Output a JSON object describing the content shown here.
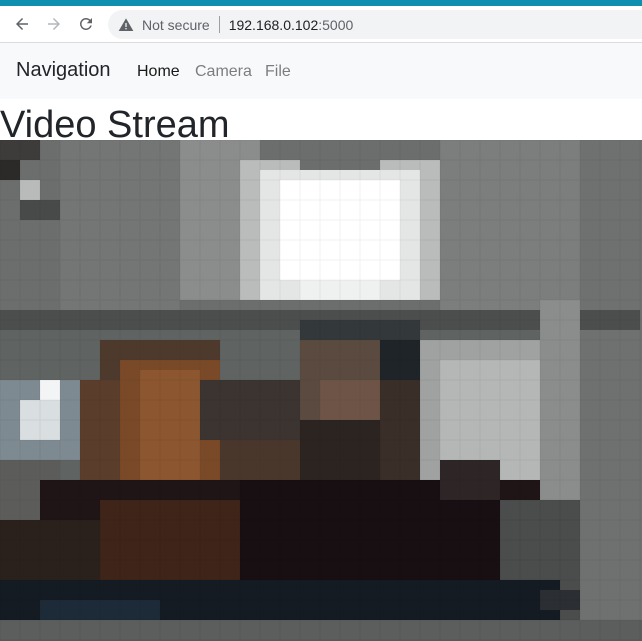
{
  "browser": {
    "security_text": "Not secure",
    "url_host": "192.168.0.102",
    "url_port": ":5000",
    "icons": [
      "back-arrow-icon",
      "forward-arrow-icon",
      "reload-icon",
      "warning-icon"
    ]
  },
  "navbar": {
    "brand": "Navigation",
    "links": [
      {
        "label": "Home",
        "active": true
      },
      {
        "label": "Camera",
        "active": false
      },
      {
        "label": "File",
        "active": false
      }
    ]
  },
  "page": {
    "title": "Video Stream"
  },
  "colors": {
    "accent_bar": "#0e8fb0",
    "navbar_bg": "#f8f9fa",
    "active_link": "#212529",
    "inactive_link": "#7f7f7f"
  }
}
